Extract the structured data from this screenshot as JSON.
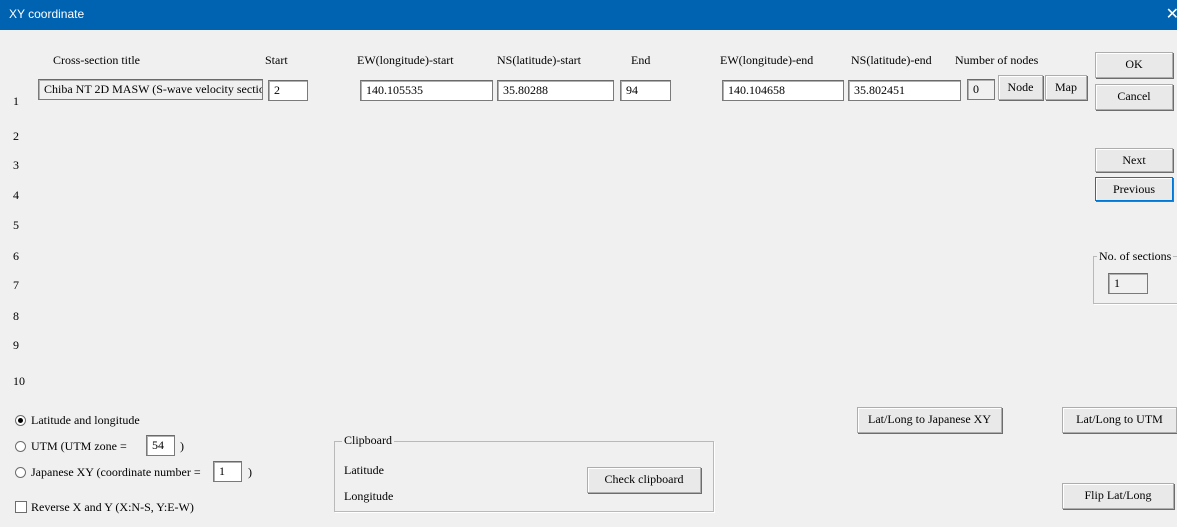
{
  "window": {
    "title": "XY coordinate",
    "close_glyph": "✕"
  },
  "headers": {
    "cross_section_title": "Cross-section title",
    "start": "Start",
    "ew_start": "EW(longitude)-start",
    "ns_start": "NS(latitude)-start",
    "end": "End",
    "ew_end": "EW(longitude)-end",
    "ns_end": "NS(latitude)-end",
    "num_nodes": "Number of nodes"
  },
  "rows": [
    {
      "num": "1",
      "title": "Chiba NT 2D MASW (S-wave velocity sectio",
      "start": "2",
      "ew_start": "140.105535",
      "ns_start": "35.80288",
      "end": "94",
      "ew_end": "140.104658",
      "ns_end": "35.802451",
      "nodes": "0"
    },
    {
      "num": "2"
    },
    {
      "num": "3"
    },
    {
      "num": "4"
    },
    {
      "num": "5"
    },
    {
      "num": "6"
    },
    {
      "num": "7"
    },
    {
      "num": "8"
    },
    {
      "num": "9"
    },
    {
      "num": "10"
    }
  ],
  "buttons": {
    "node": "Node",
    "map": "Map",
    "ok": "OK",
    "cancel": "Cancel",
    "next": "Next",
    "previous": "Previous",
    "latlong_to_japanese_xy": "Lat/Long to Japanese XY",
    "latlong_to_utm": "Lat/Long to UTM",
    "check_clipboard": "Check clipboard",
    "flip_latlong": "Flip Lat/Long"
  },
  "sections": {
    "label": "No. of sections",
    "value": "1"
  },
  "coord_system": {
    "latlong_label": "Latitude and longitude",
    "utm_label": "UTM (UTM zone =",
    "utm_zone": "54",
    "utm_close": ")",
    "japanese_label": "Japanese XY (coordinate number =",
    "japanese_number": "1",
    "japanese_close": ")",
    "selected": "latlong"
  },
  "reverse_xy": {
    "label": "Reverse X and Y (X:N-S, Y:E-W)",
    "checked": false
  },
  "clipboard": {
    "label": "Clipboard",
    "latitude_label": "Latitude",
    "longitude_label": "Longitude"
  }
}
